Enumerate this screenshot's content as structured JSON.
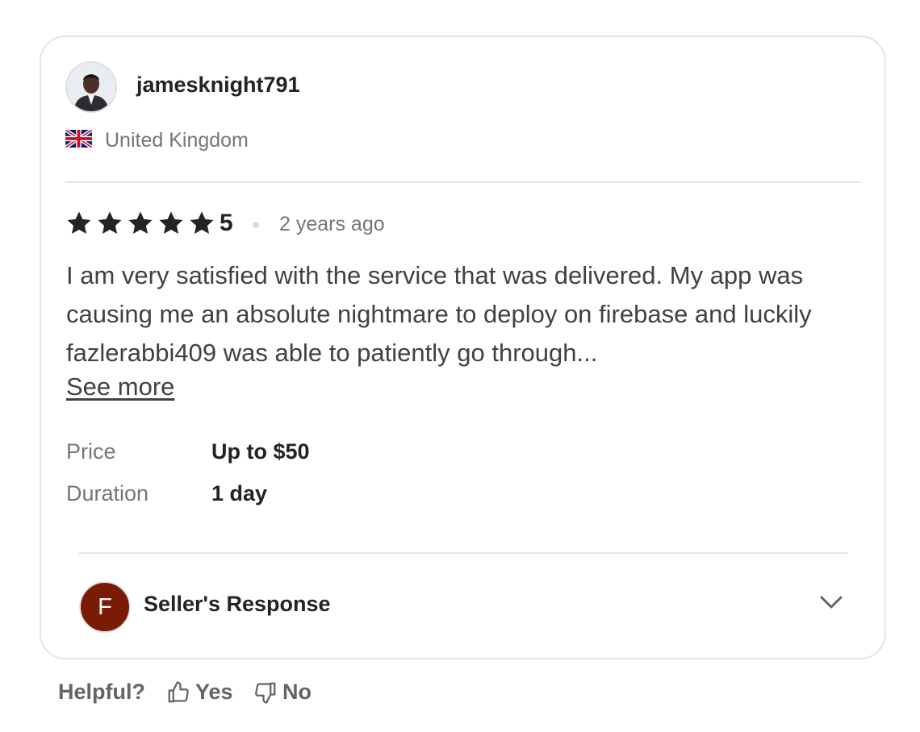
{
  "review": {
    "username": "jamesknight791",
    "country": "United Kingdom",
    "country_flag_icon": "uk-flag-icon",
    "rating": "5",
    "time_ago": "2 years ago",
    "text": "I am very satisfied with the service that was delivered. My app was causing me an absolute nightmare to deploy on firebase and luckily fazlerabbi409 was able to patiently go through...",
    "see_more_label": "See more",
    "stars_filled": 5,
    "stars_total": 5
  },
  "details": {
    "price_label": "Price",
    "price_value": "Up to $50",
    "duration_label": "Duration",
    "duration_value": "1 day"
  },
  "seller": {
    "avatar_initial": "F",
    "avatar_color": "#7a1c05",
    "response_label": "Seller's Response"
  },
  "feedback": {
    "helpful_label": "Helpful?",
    "yes_label": "Yes",
    "no_label": "No"
  }
}
